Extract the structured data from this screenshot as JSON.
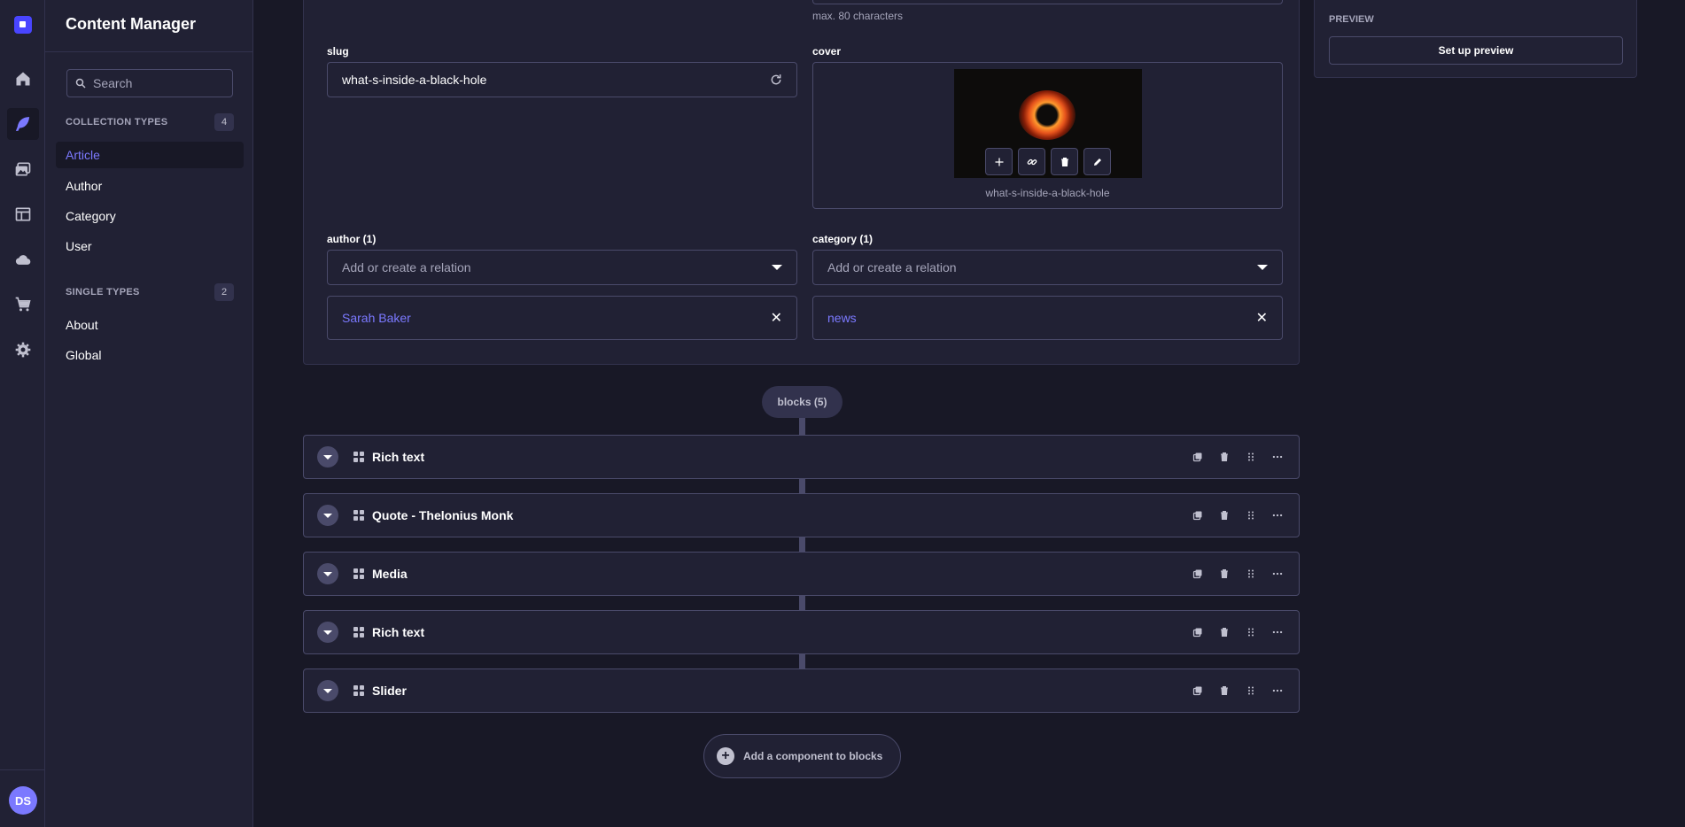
{
  "sub_nav": {
    "title": "Content Manager",
    "search_placeholder": "Search",
    "collection_types": {
      "label": "COLLECTION TYPES",
      "count": "4",
      "items": [
        "Article",
        "Author",
        "Category",
        "User"
      ]
    },
    "single_types": {
      "label": "SINGLE TYPES",
      "count": "2",
      "items": [
        "About",
        "Global"
      ]
    }
  },
  "user": {
    "initials": "DS"
  },
  "form": {
    "max_hint": "max. 80 characters",
    "slug": {
      "label": "slug",
      "value": "what-s-inside-a-black-hole"
    },
    "cover": {
      "label": "cover",
      "file_name": "what-s-inside-a-black-hole"
    },
    "author": {
      "label": "author (1)",
      "placeholder": "Add or create a relation",
      "selected": "Sarah Baker"
    },
    "category": {
      "label": "category (1)",
      "placeholder": "Add or create a relation",
      "selected": "news"
    }
  },
  "preview": {
    "label": "PREVIEW",
    "button": "Set up preview"
  },
  "blocks": {
    "chip": "blocks (5)",
    "items": [
      "Rich text",
      "Quote - Thelonius Monk",
      "Media",
      "Rich text",
      "Slider"
    ],
    "add_label": "Add a component to blocks"
  },
  "colors": {
    "primary": "#7b79ff",
    "background": "#181826",
    "surface": "#212134",
    "border": "#4a4a6a"
  }
}
